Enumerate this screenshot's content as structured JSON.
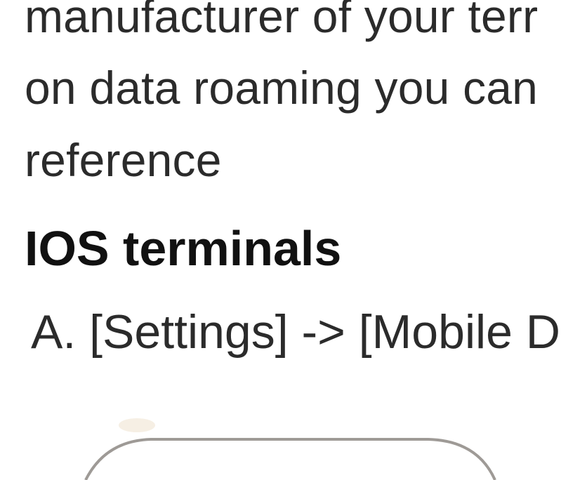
{
  "body": {
    "line_1": "manufacturer of your terr",
    "line_2": "on data roaming you can",
    "line_3": "reference"
  },
  "section": {
    "heading": "IOS terminals",
    "step_a": "A. [Settings] -> [Mobile D"
  },
  "illustration": {
    "icon": "phone-outline-icon",
    "stroke_color": "#9e9a96",
    "glow_color": "#f6efe4"
  }
}
